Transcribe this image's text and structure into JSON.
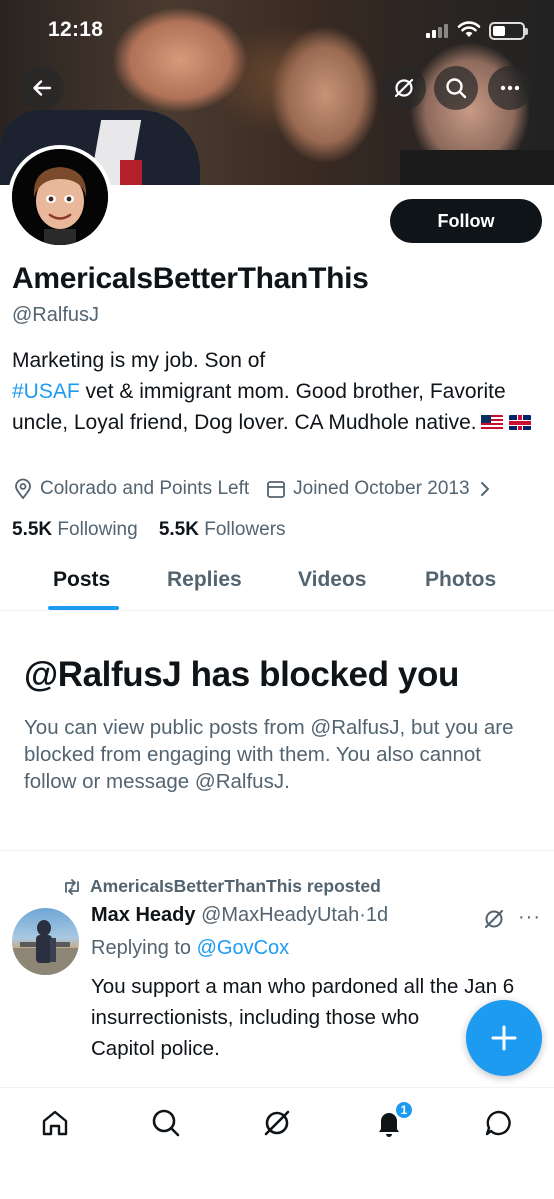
{
  "status_bar": {
    "time": "12:18"
  },
  "profile": {
    "display_name": "AmericaIsBetterThanThis",
    "handle": "@RalfusJ",
    "follow_label": "Follow",
    "bio_before_hashtag": "Marketing is my job. Son of",
    "bio_hashtag": "#USAF",
    "bio_after_hashtag": " vet & immigrant mom. Good brother, Favorite uncle, Loyal friend, Dog lover. CA Mudhole native.",
    "location": "Colorado and Points Left",
    "joined": "Joined October 2013",
    "following_count": "5.5K",
    "following_label": "Following",
    "followers_count": "5.5K",
    "followers_label": "Followers"
  },
  "tabs": [
    {
      "label": "Posts",
      "active": true
    },
    {
      "label": "Replies",
      "active": false
    },
    {
      "label": "Videos",
      "active": false
    },
    {
      "label": "Photos",
      "active": false
    }
  ],
  "blocked_notice": {
    "title": "@RalfusJ has blocked you",
    "body": "You can view public posts from @RalfusJ, but you are blocked from engaging with them. You also cannot follow or message @RalfusJ."
  },
  "post": {
    "repost_label": "AmericaIsBetterThanThis reposted",
    "author_name": "Max Heady",
    "author_handle": "@MaxHeadyUtah",
    "separator": "·",
    "time": "1d",
    "replying_prefix": "Replying to",
    "replying_to": "@GovCox",
    "text": "You support a man who pardoned all the Jan 6 insurrectionists, including those who",
    "text_line3": "Capitol police."
  },
  "bottom_nav": {
    "items": [
      "home-icon",
      "search-icon",
      "grok-icon",
      "notifications-icon",
      "messages-icon"
    ],
    "notification_badge": "1"
  },
  "colors": {
    "accent": "#1d9bf0",
    "text": "#0f1419",
    "secondary": "#536471"
  }
}
